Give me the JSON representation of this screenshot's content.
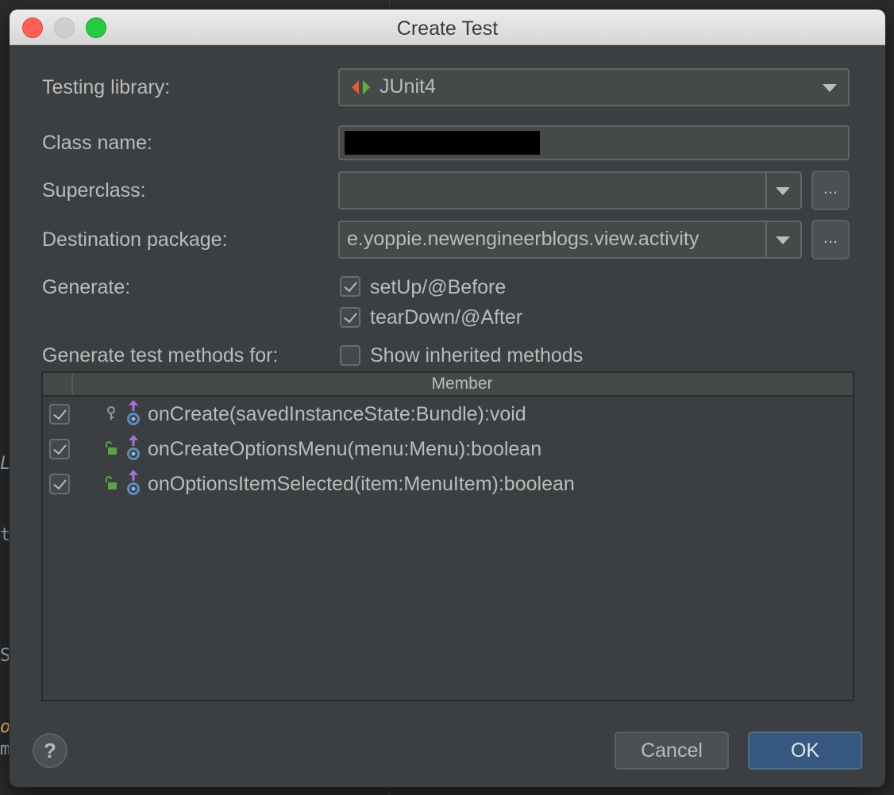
{
  "window": {
    "title": "Create Test"
  },
  "form": {
    "testing_library_label": "Testing library:",
    "testing_library_value": "JUnit4",
    "class_name_label": "Class name:",
    "class_name_value": "",
    "superclass_label": "Superclass:",
    "superclass_value": "",
    "destination_package_label": "Destination package:",
    "destination_package_value": "e.yoppie.newengineerblogs.view.activity",
    "browse_label": "...",
    "generate_label": "Generate:",
    "generate_options": [
      {
        "label": "setUp/@Before",
        "checked": true
      },
      {
        "label": "tearDown/@After",
        "checked": true
      }
    ],
    "generate_methods_label": "Generate test methods for:",
    "show_inherited_label": "Show inherited methods",
    "show_inherited_checked": false
  },
  "table": {
    "column_header": "Member",
    "rows": [
      {
        "signature": "onCreate(savedInstanceState:Bundle):void",
        "checked": true,
        "visibility": "protected"
      },
      {
        "signature": "onCreateOptionsMenu(menu:Menu):boolean",
        "checked": true,
        "visibility": "public"
      },
      {
        "signature": "onOptionsItemSelected(item:MenuItem):boolean",
        "checked": true,
        "visibility": "public"
      }
    ]
  },
  "footer": {
    "help_label": "?",
    "cancel_label": "Cancel",
    "ok_label": "OK"
  },
  "background": {
    "code_fragments": [
      "L",
      "t",
      "Se",
      "o",
      "m"
    ]
  },
  "colors": {
    "dialog_bg": "#3c3f41",
    "field_bg": "#45494a",
    "ok_button": "#365880",
    "text": "#bbbbbb",
    "redacted": "#000000",
    "junit_red": "#d95c3c",
    "junit_green": "#5fb13b",
    "method_purple": "#a473d0",
    "lock_green": "#5f9e4b"
  }
}
